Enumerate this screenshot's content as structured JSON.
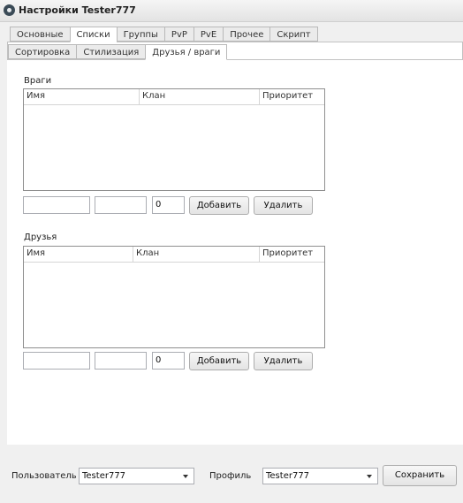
{
  "window": {
    "title": "Настройки Tester777"
  },
  "main_tabs": [
    {
      "label": "Основные",
      "active": false
    },
    {
      "label": "Списки",
      "active": true
    },
    {
      "label": "Группы",
      "active": false
    },
    {
      "label": "PvP",
      "active": false
    },
    {
      "label": "PvE",
      "active": false
    },
    {
      "label": "Прочее",
      "active": false
    },
    {
      "label": "Скрипт",
      "active": false
    }
  ],
  "sub_tabs": [
    {
      "label": "Сортировка",
      "active": false
    },
    {
      "label": "Стилизация",
      "active": false
    },
    {
      "label": "Друзья / враги",
      "active": true
    }
  ],
  "enemies": {
    "label": "Враги",
    "columns": [
      "Имя",
      "Клан",
      "Приоритет"
    ],
    "name_value": "",
    "clan_value": "",
    "priority_value": "0",
    "add_label": "Добавить",
    "remove_label": "Удалить"
  },
  "friends": {
    "label": "Друзья",
    "columns": [
      "Имя",
      "Клан",
      "Приоритет"
    ],
    "name_value": "",
    "clan_value": "",
    "priority_value": "0",
    "add_label": "Добавить",
    "remove_label": "Удалить"
  },
  "bottom": {
    "user_label": "Пользователь",
    "user_value": "Tester777",
    "profile_label": "Профиль",
    "profile_value": "Tester777",
    "save_label": "Сохранить"
  }
}
